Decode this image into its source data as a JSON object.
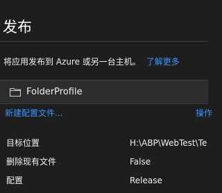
{
  "header": {
    "title": "发布"
  },
  "description": {
    "text": "将应用发布到 Azure 或另一台主机。",
    "learn_more": "了解更多"
  },
  "profile": {
    "icon": "folder-icon",
    "name": "FolderProfile"
  },
  "links": {
    "new_profile": "新建配置文件...",
    "actions": "操作"
  },
  "properties": [
    {
      "label": "目标位置",
      "value": "H:\\ABP\\WebTest\\Te"
    },
    {
      "label": "删除现有文件",
      "value": "False"
    },
    {
      "label": "配置",
      "value": "Release"
    }
  ],
  "colors": {
    "background": "#1e1e1e",
    "panel": "#2d2d30",
    "link": "#3794ff",
    "text": "#f1f1f1"
  }
}
